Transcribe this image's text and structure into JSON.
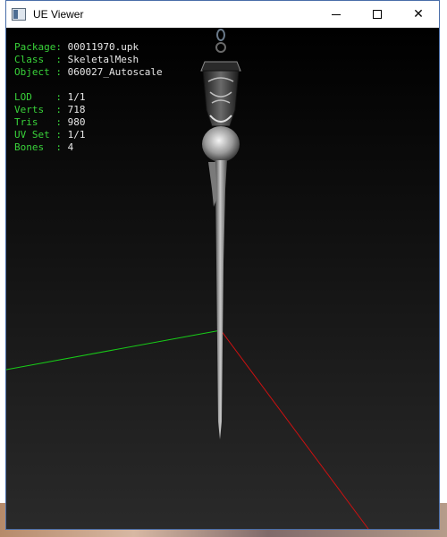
{
  "window": {
    "title": "UE Viewer",
    "minimize_symbol": "—",
    "maximize_symbol": "☐",
    "close_symbol": "✕"
  },
  "object_info": {
    "package_label": "Package:",
    "package_value": "00011970.upk",
    "class_label": "Class  :",
    "class_value": "SkeletalMesh",
    "object_label": "Object :",
    "object_value": "060027_Autoscale"
  },
  "mesh_stats": {
    "lod_label": "LOD    :",
    "lod_value": "1/1",
    "verts_label": "Verts  :",
    "verts_value": "718",
    "tris_label": "Tris   :",
    "tris_value": "980",
    "uvset_label": "UV Set :",
    "uvset_value": "1/1",
    "bones_label": "Bones  :",
    "bones_value": "4"
  },
  "colors": {
    "label_green": "#39d23a",
    "axis_x": "#cc1111",
    "axis_y": "#18cc18"
  }
}
